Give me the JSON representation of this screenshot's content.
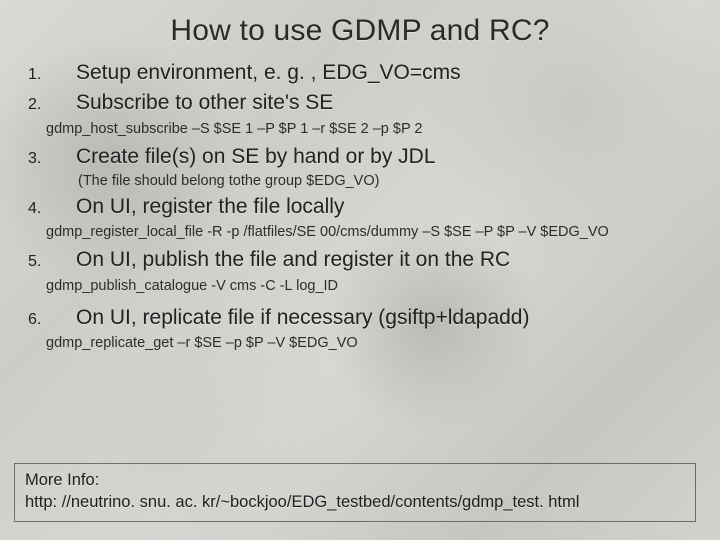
{
  "title": "How to use GDMP and RC?",
  "items": [
    {
      "num": "1.",
      "text": "Setup environment, e. g. , EDG_VO=cms"
    },
    {
      "num": "2.",
      "text": "Subscribe to other site's SE",
      "sub": "gdmp_host_subscribe –S $SE 1 –P $P 1 –r $SE 2 –p $P 2"
    },
    {
      "num": "3.",
      "text": "Create file(s) on SE by hand or by JDL",
      "sub2": "(The file should belong tothe group $EDG_VO)"
    },
    {
      "num": "4.",
      "text": "On UI, register the file locally",
      "sub": "gdmp_register_local_file -R -p /flatfiles/SE 00/cms/dummy –S $SE –P $P –V $EDG_VO"
    },
    {
      "num": "5.",
      "text": "On UI, publish the file and register it on the RC",
      "sub": "gdmp_publish_catalogue -V cms -C -L log_ID"
    },
    {
      "num": "6.",
      "text": "On UI, replicate file if necessary (gsiftp+ldapadd)",
      "sub": "gdmp_replicate_get –r $SE –p $P –V $EDG_VO"
    }
  ],
  "info": {
    "label": "More Info:",
    "url": "http: //neutrino. snu. ac. kr/~bockjoo/EDG_testbed/contents/gdmp_test. html"
  }
}
